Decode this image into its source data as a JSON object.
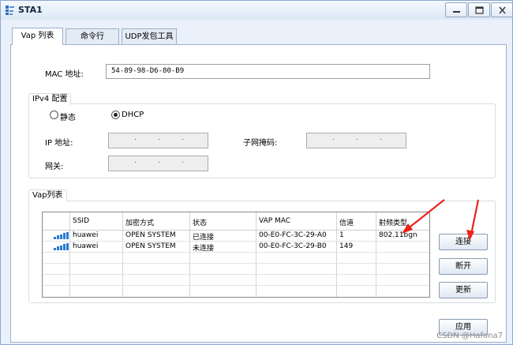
{
  "window": {
    "title": "STA1",
    "min_glyph": "—",
    "max_glyph": "☐",
    "close_glyph": "X"
  },
  "tabs": [
    {
      "label": "Vap 列表",
      "active": true
    },
    {
      "label": "命令行",
      "active": false
    },
    {
      "label": "UDP发包工具",
      "active": false
    }
  ],
  "mac": {
    "label": "MAC 地址:",
    "value": "54-89-98-D6-80-B9"
  },
  "ipv4": {
    "title": "IPv4 配置",
    "static_label": "静态",
    "dhcp_label": "DHCP",
    "selected": "DHCP",
    "ip_label": "IP 地址:",
    "mask_label": "子网掩码:",
    "gateway_label": "网关:"
  },
  "vap": {
    "title": "Vap列表",
    "columns": [
      "SSID",
      "加密方式",
      "状态",
      "VAP MAC",
      "信道",
      "射频类型"
    ],
    "rows": [
      {
        "ssid": "huawei",
        "encryption": "OPEN SYSTEM",
        "status": "已连接",
        "vap_mac": "00-E0-FC-3C-29-A0",
        "channel": "1",
        "radio": "802.11bgn"
      },
      {
        "ssid": "huawei",
        "encryption": "OPEN SYSTEM",
        "status": "未连接",
        "vap_mac": "00-E0-FC-3C-29-B0",
        "channel": "149",
        "radio": ""
      }
    ],
    "buttons": {
      "connect": "连接",
      "disconnect": "断开",
      "refresh": "更新"
    }
  },
  "apply_label": "应用",
  "watermark": "CSDN @Hafona7",
  "colors": {
    "accent": "#2a78d2",
    "annotation_arrow": "#e8231c"
  }
}
